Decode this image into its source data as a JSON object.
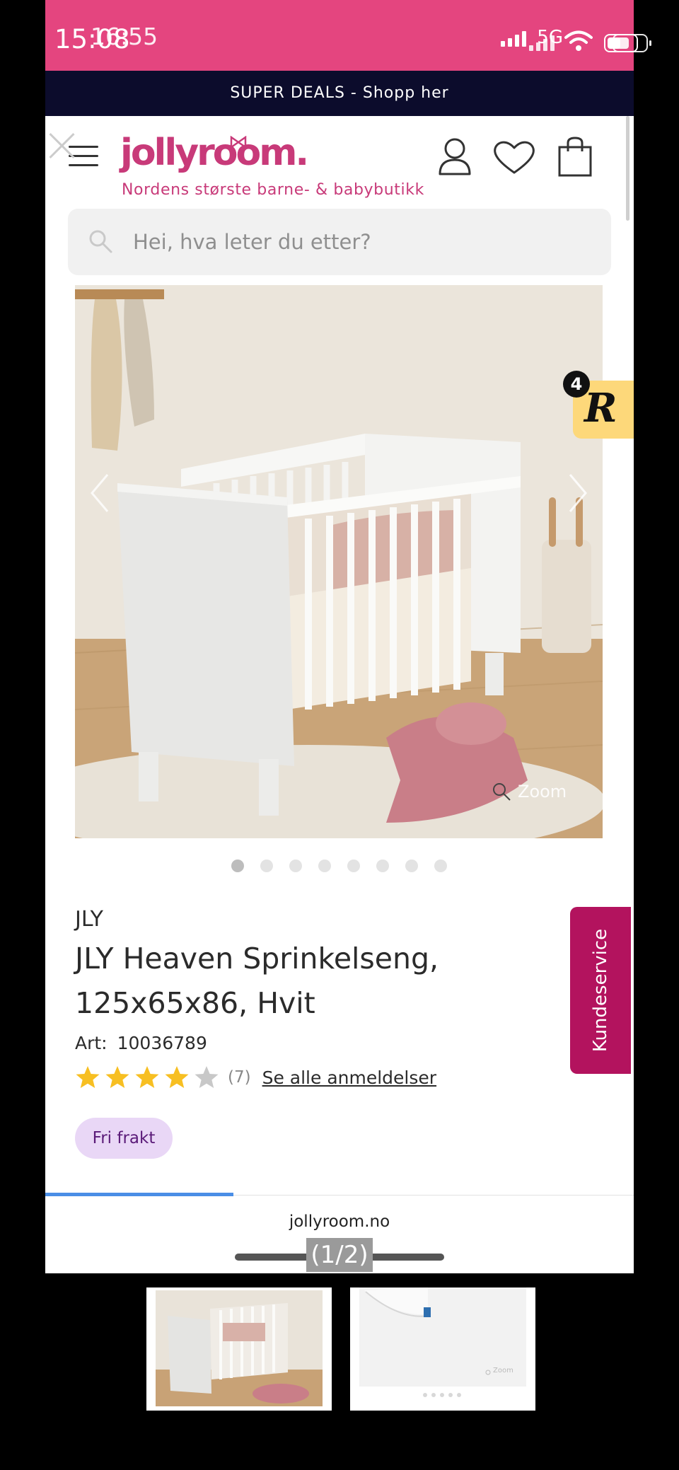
{
  "status_bar": {
    "time_primary": "15:08",
    "time_secondary": "16:55",
    "network": "5G"
  },
  "promo": {
    "text": "SUPER DEALS - Shopp her"
  },
  "header": {
    "logo": "jollyroom.",
    "tagline": "Nordens største barne- & babybutikk",
    "icons": [
      "close-icon",
      "menu-icon",
      "account-icon",
      "heart-icon",
      "shopping-bag-icon"
    ]
  },
  "search": {
    "placeholder": "Hei, hva leter du etter?"
  },
  "gallery": {
    "zoom_label": "Zoom",
    "image_count": 8,
    "active_index": 0
  },
  "rewards": {
    "letter": "R",
    "badge_count": "4"
  },
  "product": {
    "brand": "JLY",
    "title": "JLY Heaven Sprinkelseng, 125x65x86, Hvit",
    "art_label": "Art:",
    "art_number": "10036789",
    "rating": 4,
    "rating_max": 5,
    "review_count": "(7)",
    "reviews_link": "Se alle anmeldelser",
    "badge": "Fri frakt"
  },
  "customer_service": {
    "label": "Kundeservice"
  },
  "browser": {
    "url": "jollyroom.no",
    "load_progress": 0.32
  },
  "viewer": {
    "counter": "(1/2)",
    "thumbnails": [
      "crib-room-thumbnail",
      "mattress-thumbnail"
    ],
    "thumb2_zoom": "Zoom"
  },
  "colors": {
    "status_bg": "#e4457f",
    "promo_bg": "#0c0c2c",
    "brand": "#c83a79",
    "brand_dark": "#b3135e",
    "lavender": "#e9d7f6",
    "yellow": "#fdd87a",
    "star": "#f7bf22"
  }
}
